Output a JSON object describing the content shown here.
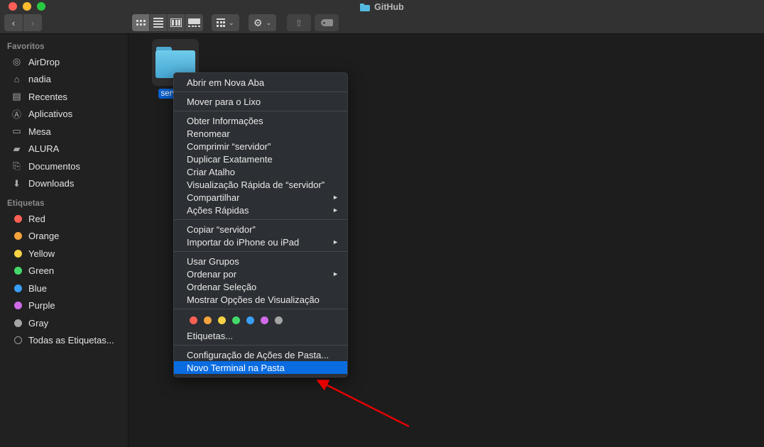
{
  "window": {
    "title": "GitHub",
    "title_icon": "folder-icon",
    "traffic_lights": [
      {
        "name": "close-button",
        "color": "#ff5f57"
      },
      {
        "name": "minimize-button",
        "color": "#febc2e"
      },
      {
        "name": "maximize-button",
        "color": "#28c840"
      }
    ]
  },
  "toolbar": {
    "back_label": "‹",
    "forward_label": "›",
    "view_buttons": [
      {
        "name": "icon-view",
        "icon": "grid-icon",
        "active": true
      },
      {
        "name": "list-view",
        "icon": "list-icon",
        "active": false
      },
      {
        "name": "column-view",
        "icon": "columns-icon",
        "active": false
      },
      {
        "name": "gallery-view",
        "icon": "gallery-icon",
        "active": false
      }
    ],
    "group_by": {
      "name": "group-by-button",
      "icon": "grid-group-icon",
      "chevron": "⌄"
    },
    "action": {
      "name": "action-gear-button",
      "icon": "gear-icon",
      "glyph": "⚙",
      "chevron": "⌄"
    },
    "share": {
      "name": "share-button",
      "icon": "share-icon",
      "glyph": "⇧"
    },
    "tag": {
      "name": "tag-button",
      "icon": "tag-icon"
    }
  },
  "sidebar": {
    "sections": [
      {
        "header": "Favoritos",
        "items": [
          {
            "label": "AirDrop",
            "icon": "airdrop-icon",
            "glyph": "◎"
          },
          {
            "label": "nadia",
            "icon": "home-icon",
            "glyph": "⌂"
          },
          {
            "label": "Recentes",
            "icon": "recents-icon",
            "glyph": "▤"
          },
          {
            "label": "Aplicativos",
            "icon": "applications-icon",
            "glyph": "Ⓐ"
          },
          {
            "label": "Mesa",
            "icon": "desktop-icon",
            "glyph": "▭"
          },
          {
            "label": "ALURA",
            "icon": "folder-icon",
            "glyph": "▰"
          },
          {
            "label": "Documentos",
            "icon": "documents-icon",
            "glyph": "⎘"
          },
          {
            "label": "Downloads",
            "icon": "downloads-icon",
            "glyph": "⬇"
          }
        ]
      },
      {
        "header": "Etiquetas",
        "items": [
          {
            "label": "Red",
            "icon": "tag-dot-red",
            "color": "#fb6054"
          },
          {
            "label": "Orange",
            "icon": "tag-dot-orange",
            "color": "#f5a33c"
          },
          {
            "label": "Yellow",
            "icon": "tag-dot-yellow",
            "color": "#f7d246"
          },
          {
            "label": "Green",
            "icon": "tag-dot-green",
            "color": "#43d96a"
          },
          {
            "label": "Blue",
            "icon": "tag-dot-blue",
            "color": "#3a9ef5"
          },
          {
            "label": "Purple",
            "icon": "tag-dot-purple",
            "color": "#cf6ae8"
          },
          {
            "label": "Gray",
            "icon": "tag-dot-gray",
            "color": "#a5a5a5"
          },
          {
            "label": "Todas as Etiquetas...",
            "icon": "tag-dot-all",
            "color": "ring"
          }
        ]
      }
    ]
  },
  "content": {
    "selected_file": {
      "label": "servidor",
      "icon": "folder-icon",
      "selected": true
    }
  },
  "context_menu": {
    "groups": [
      {
        "items": [
          {
            "label": "Abrir em Nova Aba",
            "submenu": false,
            "highlighted": false
          }
        ]
      },
      {
        "items": [
          {
            "label": "Mover para o Lixo",
            "submenu": false,
            "highlighted": false
          }
        ]
      },
      {
        "items": [
          {
            "label": "Obter Informações",
            "submenu": false,
            "highlighted": false
          },
          {
            "label": "Renomear",
            "submenu": false,
            "highlighted": false
          },
          {
            "label": "Comprimir “servidor”",
            "submenu": false,
            "highlighted": false
          },
          {
            "label": "Duplicar Exatamente",
            "submenu": false,
            "highlighted": false
          },
          {
            "label": "Criar Atalho",
            "submenu": false,
            "highlighted": false
          },
          {
            "label": "Visualização Rápida de “servidor”",
            "submenu": false,
            "highlighted": false
          },
          {
            "label": "Compartilhar",
            "submenu": true,
            "highlighted": false
          },
          {
            "label": "Ações Rápidas",
            "submenu": true,
            "highlighted": false
          }
        ]
      },
      {
        "items": [
          {
            "label": "Copiar “servidor”",
            "submenu": false,
            "highlighted": false
          },
          {
            "label": "Importar do iPhone ou iPad",
            "submenu": true,
            "highlighted": false
          }
        ]
      },
      {
        "items": [
          {
            "label": "Usar Grupos",
            "submenu": false,
            "highlighted": false
          },
          {
            "label": "Ordenar por",
            "submenu": true,
            "highlighted": false
          },
          {
            "label": "Ordenar Seleção",
            "submenu": false,
            "highlighted": false
          },
          {
            "label": "Mostrar Opções de Visualização",
            "submenu": false,
            "highlighted": false
          }
        ]
      },
      {
        "tag_dots": [
          "#fb6054",
          "#f5a33c",
          "#f7d246",
          "#43d96a",
          "#3a9ef5",
          "#cf6ae8",
          "#a5a5a5"
        ],
        "items": [
          {
            "label": "Etiquetas...",
            "submenu": false,
            "highlighted": false
          }
        ]
      },
      {
        "items": [
          {
            "label": "Configuração de Ações de Pasta...",
            "submenu": false,
            "highlighted": false
          },
          {
            "label": "Novo Terminal na Pasta",
            "submenu": false,
            "highlighted": true
          }
        ]
      }
    ],
    "highlight_color": "#0a6ce0"
  },
  "annotation": {
    "arrow_color": "#e60000",
    "name": "red-pointer-arrow"
  }
}
